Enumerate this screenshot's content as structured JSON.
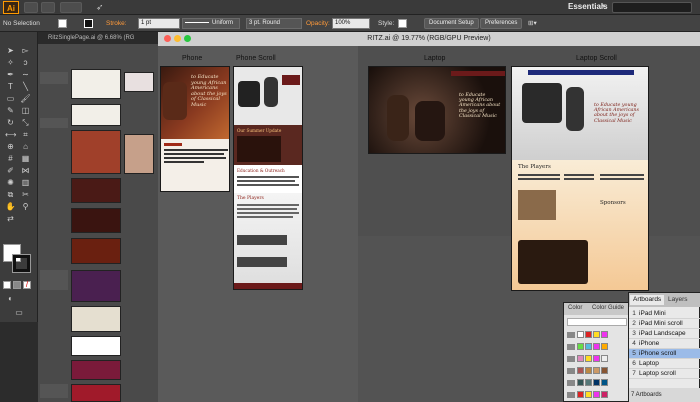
{
  "app": {
    "logo": "Ai",
    "workspace": "Essentials"
  },
  "control_bar": {
    "selection": "No Selection",
    "stroke_label": "Stroke:",
    "stroke_weight": "1 pt",
    "profile": "Uniform",
    "brush": "3 pt. Round",
    "opacity_label": "Opacity:",
    "opacity_value": "100%",
    "style_label": "Style:",
    "document_setup": "Document Setup",
    "preferences": "Preferences"
  },
  "left_document": {
    "tab_title": "RitzSinglePage.ai @ 6.68% (RG"
  },
  "main_document": {
    "title": "RITZ.ai @ 19.77% (RGB/GPU Preview)",
    "artboard_labels": {
      "phone": "Phone",
      "phone_scroll": "Phone Scroll",
      "laptop": "Laptop",
      "laptop_scroll": "Laptop Scroll"
    },
    "page_text": {
      "tagline": "to Educate young African Americans about the joys of Classical Music",
      "our_summer_update": "Our Summer Update",
      "education_outreach": "Education & Outreach",
      "the_players": "The Players",
      "sponsors": "Sponsors"
    }
  },
  "artboards_panel": {
    "tabs": [
      "Artboards",
      "Layers"
    ],
    "items": [
      {
        "num": "1",
        "name": "iPad Mini"
      },
      {
        "num": "2",
        "name": "iPad Mini scroll"
      },
      {
        "num": "3",
        "name": "iPad Landscape"
      },
      {
        "num": "4",
        "name": "iPhone"
      },
      {
        "num": "5",
        "name": "iPhone scroll"
      },
      {
        "num": "6",
        "name": "Laptop"
      },
      {
        "num": "7",
        "name": "Laptop scroll"
      }
    ],
    "footer": "7 Artboards",
    "selected_index": 4
  },
  "color_panel": {
    "tabs": [
      "Color",
      "Color Guide"
    ]
  },
  "colors": {
    "accent_orange": "#ff9a00",
    "selection_blue": "#9bbbe8",
    "maroon": "#6b1a1a"
  }
}
